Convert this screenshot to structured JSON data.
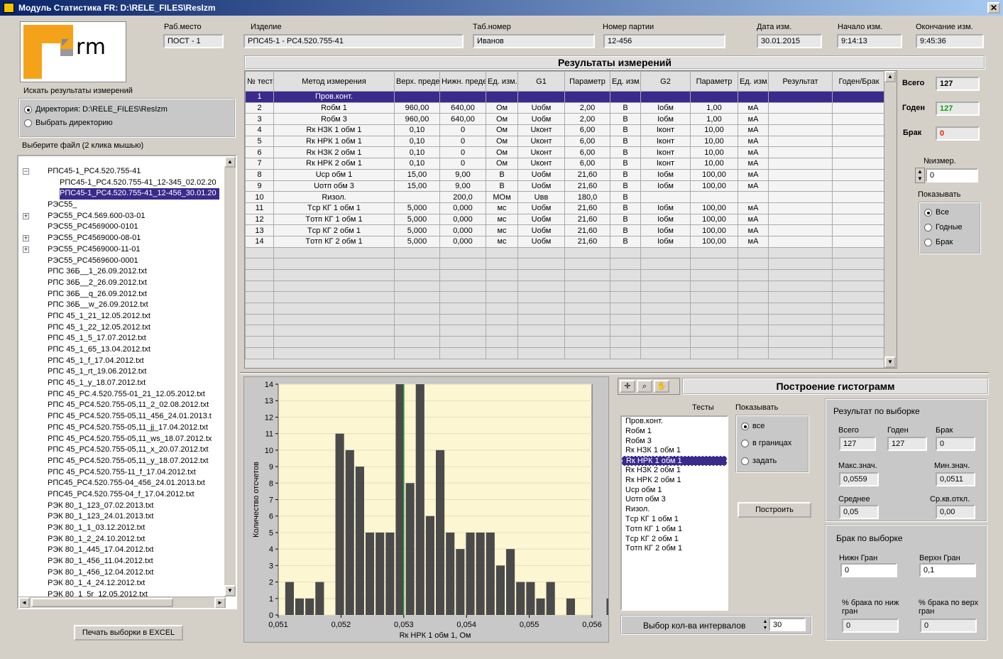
{
  "window": {
    "title": "Модуль Статистика FR:  D:\\RELE_FILES\\ResIzm",
    "close_label": "✕"
  },
  "logo_text": "Form",
  "header": {
    "workplace": {
      "label": "Раб.место",
      "value": "ПОСТ - 1"
    },
    "product": {
      "label": "Изделие",
      "value": "РПС45-1 - РС4.520.755-41"
    },
    "tabno": {
      "label": "Таб.номер",
      "value": "Иванов"
    },
    "batch": {
      "label": "Номер партии",
      "value": "12-456"
    },
    "date": {
      "label": "Дата изм.",
      "value": "30.01.2015"
    },
    "start": {
      "label": "Начало изм.",
      "value": "9:14:13"
    },
    "end": {
      "label": "Окончание изм.",
      "value": "9:45:36"
    }
  },
  "search": {
    "label": "Искать результаты измерений",
    "opt_dir": "Директория: D:\\RELE_FILES\\ResIzm",
    "opt_choose": "Выбрать директорию",
    "file_label": "Выберите файл (2 клика мышью)"
  },
  "files": [
    {
      "text": "РПС45-1_РС4.520.755-41",
      "level": 0,
      "expander": "−"
    },
    {
      "text": "РПС45-1_РС4.520.755-41_12-345_02.02.20",
      "level": 1,
      "expander": ""
    },
    {
      "text": "РПС45-1_РС4.520.755-41_12-456_30.01.20",
      "level": 1,
      "expander": "",
      "selected": true
    },
    {
      "text": "РЭС55_",
      "level": 0,
      "expander": ""
    },
    {
      "text": "РЭС55_РС4.569.600-03-01",
      "level": 0,
      "expander": "+"
    },
    {
      "text": "РЭС55_РС4569000-0101",
      "level": 0,
      "expander": ""
    },
    {
      "text": "РЭС55_РС4569000-08-01",
      "level": 0,
      "expander": "+"
    },
    {
      "text": "РЭС55_РС4569000-11-01",
      "level": 0,
      "expander": "+"
    },
    {
      "text": "РЭС55_РС4569600-0001",
      "level": 0,
      "expander": ""
    },
    {
      "text": "РПС 36Б__1_26.09.2012.txt",
      "level": 0,
      "expander": ""
    },
    {
      "text": "РПС 36Б__2_26.09.2012.txt",
      "level": 0,
      "expander": ""
    },
    {
      "text": "РПС 36Б__q_26.09.2012.txt",
      "level": 0,
      "expander": ""
    },
    {
      "text": "РПС 36Б__w_26.09.2012.txt",
      "level": 0,
      "expander": ""
    },
    {
      "text": "РПС 45_1_21_12.05.2012.txt",
      "level": 0,
      "expander": ""
    },
    {
      "text": "РПС 45_1_22_12.05.2012.txt",
      "level": 0,
      "expander": ""
    },
    {
      "text": "РПС 45_1_5_17.07.2012.txt",
      "level": 0,
      "expander": ""
    },
    {
      "text": "РПС 45_1_65_13.04.2012.txt",
      "level": 0,
      "expander": ""
    },
    {
      "text": "РПС 45_1_f_17.04.2012.txt",
      "level": 0,
      "expander": ""
    },
    {
      "text": "РПС 45_1_rt_19.06.2012.txt",
      "level": 0,
      "expander": ""
    },
    {
      "text": "РПС 45_1_y_18.07.2012.txt",
      "level": 0,
      "expander": ""
    },
    {
      "text": "РПС 45_РС.4.520.755-01_21_12.05.2012.txt",
      "level": 0,
      "expander": ""
    },
    {
      "text": "РПС 45_РС4.520.755-05,11_2_02.08.2012.txt",
      "level": 0,
      "expander": ""
    },
    {
      "text": "РПС 45_РС4.520.755-05,11_456_24.01.2013.t",
      "level": 0,
      "expander": ""
    },
    {
      "text": "РПС 45_РС4.520.755-05,11_jj_17.04.2012.txt",
      "level": 0,
      "expander": ""
    },
    {
      "text": "РПС 45_РС4.520.755-05,11_ws_18.07.2012.tx",
      "level": 0,
      "expander": ""
    },
    {
      "text": "РПС 45_РС4.520.755-05,11_x_20.07.2012.txt",
      "level": 0,
      "expander": ""
    },
    {
      "text": "РПС 45_РС4.520.755-05,11_y_18.07.2012.txt",
      "level": 0,
      "expander": ""
    },
    {
      "text": "РПС 45_РС4.520.755-11_f_17.04.2012.txt",
      "level": 0,
      "expander": ""
    },
    {
      "text": "РПС45_РС4.520.755-04_456_24.01.2013.txt",
      "level": 0,
      "expander": ""
    },
    {
      "text": "РПС45_РС4.520.755-04_f_17.04.2012.txt",
      "level": 0,
      "expander": ""
    },
    {
      "text": "РЭК 80_1_123_07.02.2013.txt",
      "level": 0,
      "expander": ""
    },
    {
      "text": "РЭК 80_1_123_24.01.2013.txt",
      "level": 0,
      "expander": ""
    },
    {
      "text": "РЭК 80_1_1_03.12.2012.txt",
      "level": 0,
      "expander": ""
    },
    {
      "text": "РЭК 80_1_2_24.10.2012.txt",
      "level": 0,
      "expander": ""
    },
    {
      "text": "РЭК 80_1_445_17.04.2012.txt",
      "level": 0,
      "expander": ""
    },
    {
      "text": "РЭК 80_1_456_11.04.2012.txt",
      "level": 0,
      "expander": ""
    },
    {
      "text": "РЭК 80_1_456_12.04.2012.txt",
      "level": 0,
      "expander": ""
    },
    {
      "text": "РЭК 80_1_4_24.12.2012.txt",
      "level": 0,
      "expander": ""
    },
    {
      "text": "РЭК 80_1_5r_12.05.2012.txt",
      "level": 0,
      "expander": ""
    }
  ],
  "print_button": "Печать выборки  в EXCEL",
  "results": {
    "title": "Результаты измерений",
    "columns": [
      "№ теста",
      "Метод измерения",
      "Верх. предел",
      "Нижн. предел",
      "Ед. изм.",
      "G1",
      "Параметр",
      "Ед. изм.",
      "G2",
      "Параметр",
      "Ед. изм.",
      "Результат",
      "Годен/Брак"
    ],
    "rows": [
      [
        "1",
        "Пров.конт.",
        "",
        "",
        "",
        "",
        "",
        "",
        "",
        "",
        "",
        "",
        ""
      ],
      [
        "2",
        "Rобм 1",
        "960,00",
        "640,00",
        "Ом",
        "Uобм",
        "2,00",
        "В",
        "Iобм",
        "1,00",
        "мА",
        "",
        ""
      ],
      [
        "3",
        "Rобм 3",
        "960,00",
        "640,00",
        "Ом",
        "Uобм",
        "2,00",
        "В",
        "Iобм",
        "1,00",
        "мА",
        "",
        ""
      ],
      [
        "4",
        "Rк НЗК 1 обм 1",
        "0,10",
        "0",
        "Ом",
        "Uконт",
        "6,00",
        "В",
        "Iконт",
        "10,00",
        "мА",
        "",
        ""
      ],
      [
        "5",
        "Rк НРК 1 обм 1",
        "0,10",
        "0",
        "Ом",
        "Uконт",
        "6,00",
        "В",
        "Iконт",
        "10,00",
        "мА",
        "",
        ""
      ],
      [
        "6",
        "Rк НЗК 2 обм 1",
        "0,10",
        "0",
        "Ом",
        "Uконт",
        "6,00",
        "В",
        "Iконт",
        "10,00",
        "мА",
        "",
        ""
      ],
      [
        "7",
        "Rк НРК 2 обм 1",
        "0,10",
        "0",
        "Ом",
        "Uконт",
        "6,00",
        "В",
        "Iконт",
        "10,00",
        "мА",
        "",
        ""
      ],
      [
        "8",
        "Uср обм 1",
        "15,00",
        "9,00",
        "В",
        "Uобм",
        "21,60",
        "В",
        "Iобм",
        "100,00",
        "мА",
        "",
        ""
      ],
      [
        "9",
        "Uотп обм 3",
        "15,00",
        "9,00",
        "В",
        "Uобм",
        "21,60",
        "В",
        "Iобм",
        "100,00",
        "мА",
        "",
        ""
      ],
      [
        "10",
        "Rизол.",
        "",
        "200,0",
        "МОм",
        "Uвв",
        "180,0",
        "В",
        "",
        "",
        "",
        "",
        ""
      ],
      [
        "11",
        "Tср КГ 1 обм 1",
        "5,000",
        "0,000",
        "мс",
        "Uобм",
        "21,60",
        "В",
        "Iобм",
        "100,00",
        "мА",
        "",
        ""
      ],
      [
        "12",
        "Tотп КГ 1 обм 1",
        "5,000",
        "0,000",
        "мс",
        "Uобм",
        "21,60",
        "В",
        "Iобм",
        "100,00",
        "мА",
        "",
        ""
      ],
      [
        "13",
        "Tср КГ 2 обм 1",
        "5,000",
        "0,000",
        "мс",
        "Uобм",
        "21,60",
        "В",
        "Iобм",
        "100,00",
        "мА",
        "",
        ""
      ],
      [
        "14",
        "Tотп КГ 2 обм 1",
        "5,000",
        "0,000",
        "мс",
        "Uобм",
        "21,60",
        "В",
        "Iобм",
        "100,00",
        "мА",
        "",
        ""
      ]
    ]
  },
  "summary": {
    "total_label": "Всего",
    "total": "127",
    "good_label": "Годен",
    "good": "127",
    "bad_label": "Брак",
    "bad": "0",
    "meas_label": "№измер.",
    "meas": "0",
    "show_label": "Показывать",
    "show_opts": [
      "Все",
      "Годные",
      "Брак"
    ],
    "colors": {
      "good": "#10a010",
      "bad": "#e02000"
    }
  },
  "hist": {
    "title": "Построение гистограмм",
    "tests_label": "Тесты",
    "show_label": "Показывать",
    "tests": [
      "Пров.конт.",
      "Rобм 1",
      "Rобм 3",
      "Rк НЗК 1 обм 1",
      "Rк НРК 1 обм 1",
      "Rк НЗК 2 обм 1",
      "Rк НРК 2 обм 1",
      "Uср обм 1",
      "Uотп обм 3",
      "Rизол.",
      "Tср КГ 1 обм 1",
      "Tотп КГ 1 обм 1",
      "Tср КГ 2 обм 1",
      "Tотп КГ 2 обм 1"
    ],
    "selected_test_index": 4,
    "show_opts": [
      "все",
      "в границах",
      "задать"
    ],
    "build_button": "Построить",
    "intervals_label": "Выбор кол-ва интервалов",
    "intervals": "30"
  },
  "sample": {
    "title": "Результат по выборке",
    "total_label": "Всего",
    "total": "127",
    "good_label": "Годен",
    "good": "127",
    "bad_label": "Брак",
    "bad": "0",
    "max_label": "Макс.знач.",
    "max": "0,0559",
    "min_label": "Мин.знач.",
    "min": "0,0511",
    "mean_label": "Среднее",
    "mean": "0,05",
    "std_label": "Ср.кв.откл.",
    "std": "0,00"
  },
  "reject": {
    "title": "Брак по выборке",
    "low_label": "Нижн Гран",
    "low": "0",
    "high_label": "Верхн Гран",
    "high": "0,1",
    "pct_low_label": "% брака по ниж гран",
    "pct_low": "0",
    "pct_high_label": "% брака по верх гран",
    "pct_high": "0"
  },
  "chart_data": {
    "type": "bar",
    "xlabel": "Rк НРК 1 обм 1, Ом",
    "ylabel": "Количество отсчетов",
    "xlim": [
      0.051,
      0.056
    ],
    "ylim": [
      0,
      14
    ],
    "x_ticks": [
      "0,051",
      "0,052",
      "0,053",
      "0,054",
      "0,055",
      "0,056"
    ],
    "y_ticks": [
      "0",
      "1",
      "2",
      "3",
      "4",
      "5",
      "6",
      "7",
      "8",
      "9",
      "10",
      "11",
      "12",
      "13",
      "14"
    ],
    "bin_start": 0.0511,
    "bin_width": 0.00016,
    "values": [
      2,
      1,
      1,
      2,
      0,
      11,
      10,
      9,
      5,
      5,
      5,
      14,
      8,
      14,
      6,
      10,
      5,
      4,
      5,
      5,
      5,
      3,
      4,
      2,
      2,
      1,
      2,
      0,
      1,
      0,
      0,
      0,
      1
    ],
    "marker_x": 0.053,
    "bar_color": "#4a4a4a",
    "bg_color": "#fdf6d2",
    "marker_color": "#20a040",
    "grid": true
  }
}
